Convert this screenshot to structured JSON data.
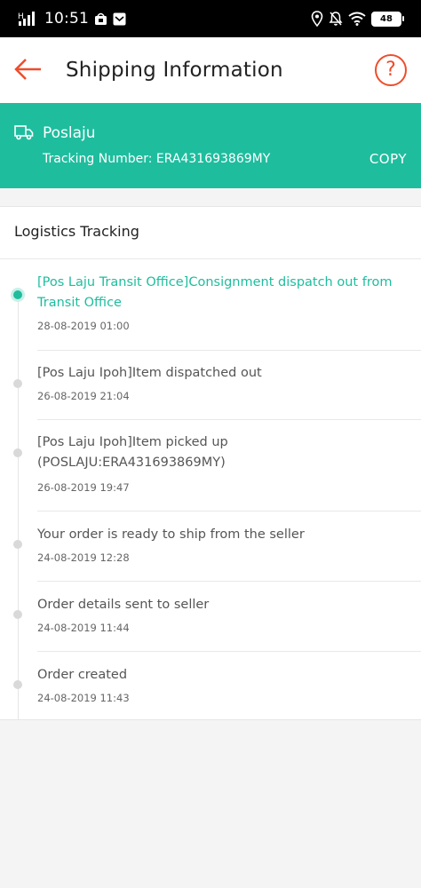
{
  "status_bar": {
    "signal_text": "H",
    "time": "10:51",
    "battery": "48"
  },
  "header": {
    "title": "Shipping Information"
  },
  "carrier": {
    "name": "Poslaju",
    "tracking_label": "Tracking Number: ERA431693869MY",
    "copy_label": "COPY"
  },
  "logistics": {
    "title": "Logistics Tracking",
    "events": [
      {
        "description": "[Pos Laju Transit Office]Consignment dispatch out from Transit Office",
        "time": "28-08-2019 01:00",
        "active": true
      },
      {
        "description": "[Pos Laju Ipoh]Item dispatched out",
        "time": "26-08-2019 21:04",
        "active": false
      },
      {
        "description": "[Pos Laju Ipoh]Item picked up (POSLAJU:ERA431693869MY)",
        "time": "26-08-2019 19:47",
        "active": false
      },
      {
        "description": "Your order is ready to ship from the seller",
        "time": "24-08-2019 12:28",
        "active": false
      },
      {
        "description": "Order details sent to seller",
        "time": "24-08-2019 11:44",
        "active": false
      },
      {
        "description": "Order created",
        "time": "24-08-2019 11:43",
        "active": false
      }
    ]
  },
  "colors": {
    "accent": "#1ebd9e",
    "brand": "#ee4d2d"
  }
}
